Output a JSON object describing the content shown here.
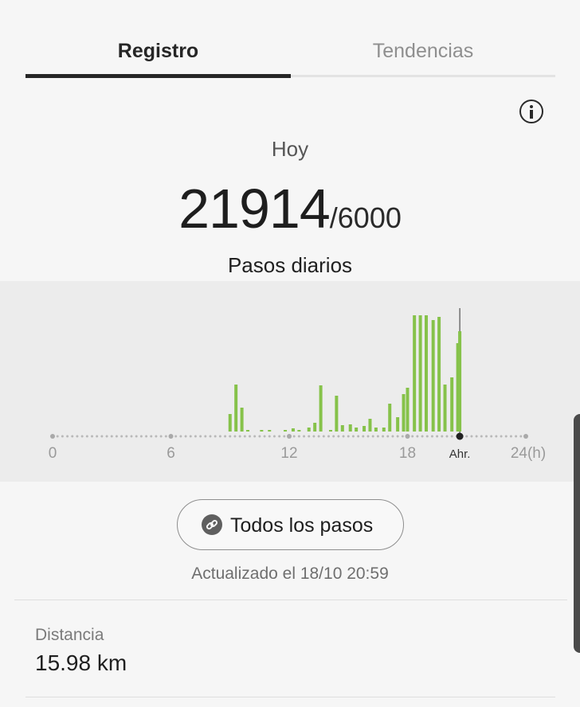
{
  "tabs": {
    "registro": "Registro",
    "tendencias": "Tendencias"
  },
  "info_icon": "info-icon",
  "today_label": "Hoy",
  "steps": {
    "count": "21914",
    "goal": "/6000",
    "label": "Pasos diarios"
  },
  "chart_data": {
    "type": "bar",
    "x_ticks": [
      "0",
      "6",
      "12",
      "18",
      "Ahr.",
      "24(h)"
    ],
    "bar_color": "#86c24a",
    "x_unit": "h",
    "current_hour": 20.65,
    "x": [
      9.0,
      9.3,
      9.6,
      9.9,
      10.6,
      11.0,
      11.8,
      12.2,
      12.5,
      13.0,
      13.3,
      13.6,
      14.1,
      14.4,
      14.7,
      15.1,
      15.4,
      15.8,
      16.1,
      16.4,
      16.8,
      17.1,
      17.5,
      17.8,
      18.0,
      18.35,
      18.65,
      18.95,
      19.3,
      19.6,
      19.9,
      20.25,
      20.55
    ],
    "values": [
      22,
      59,
      30,
      2,
      2,
      2,
      2,
      4,
      2,
      5,
      11,
      58,
      2,
      45,
      8,
      9,
      5,
      7,
      16,
      5,
      5,
      35,
      18,
      47,
      55,
      146,
      146,
      146,
      140,
      144,
      59,
      68,
      111
    ],
    "current_value": 126
  },
  "all_steps_button": {
    "label": "Todos los pasos",
    "icon": "link-icon"
  },
  "updated_text": "Actualizado el 18/10 20:59",
  "distance": {
    "label": "Distancia",
    "value": "15.98 km"
  },
  "colors": {
    "accent": "#86c24a",
    "tab_active": "#262626",
    "panel": "#ececec"
  }
}
